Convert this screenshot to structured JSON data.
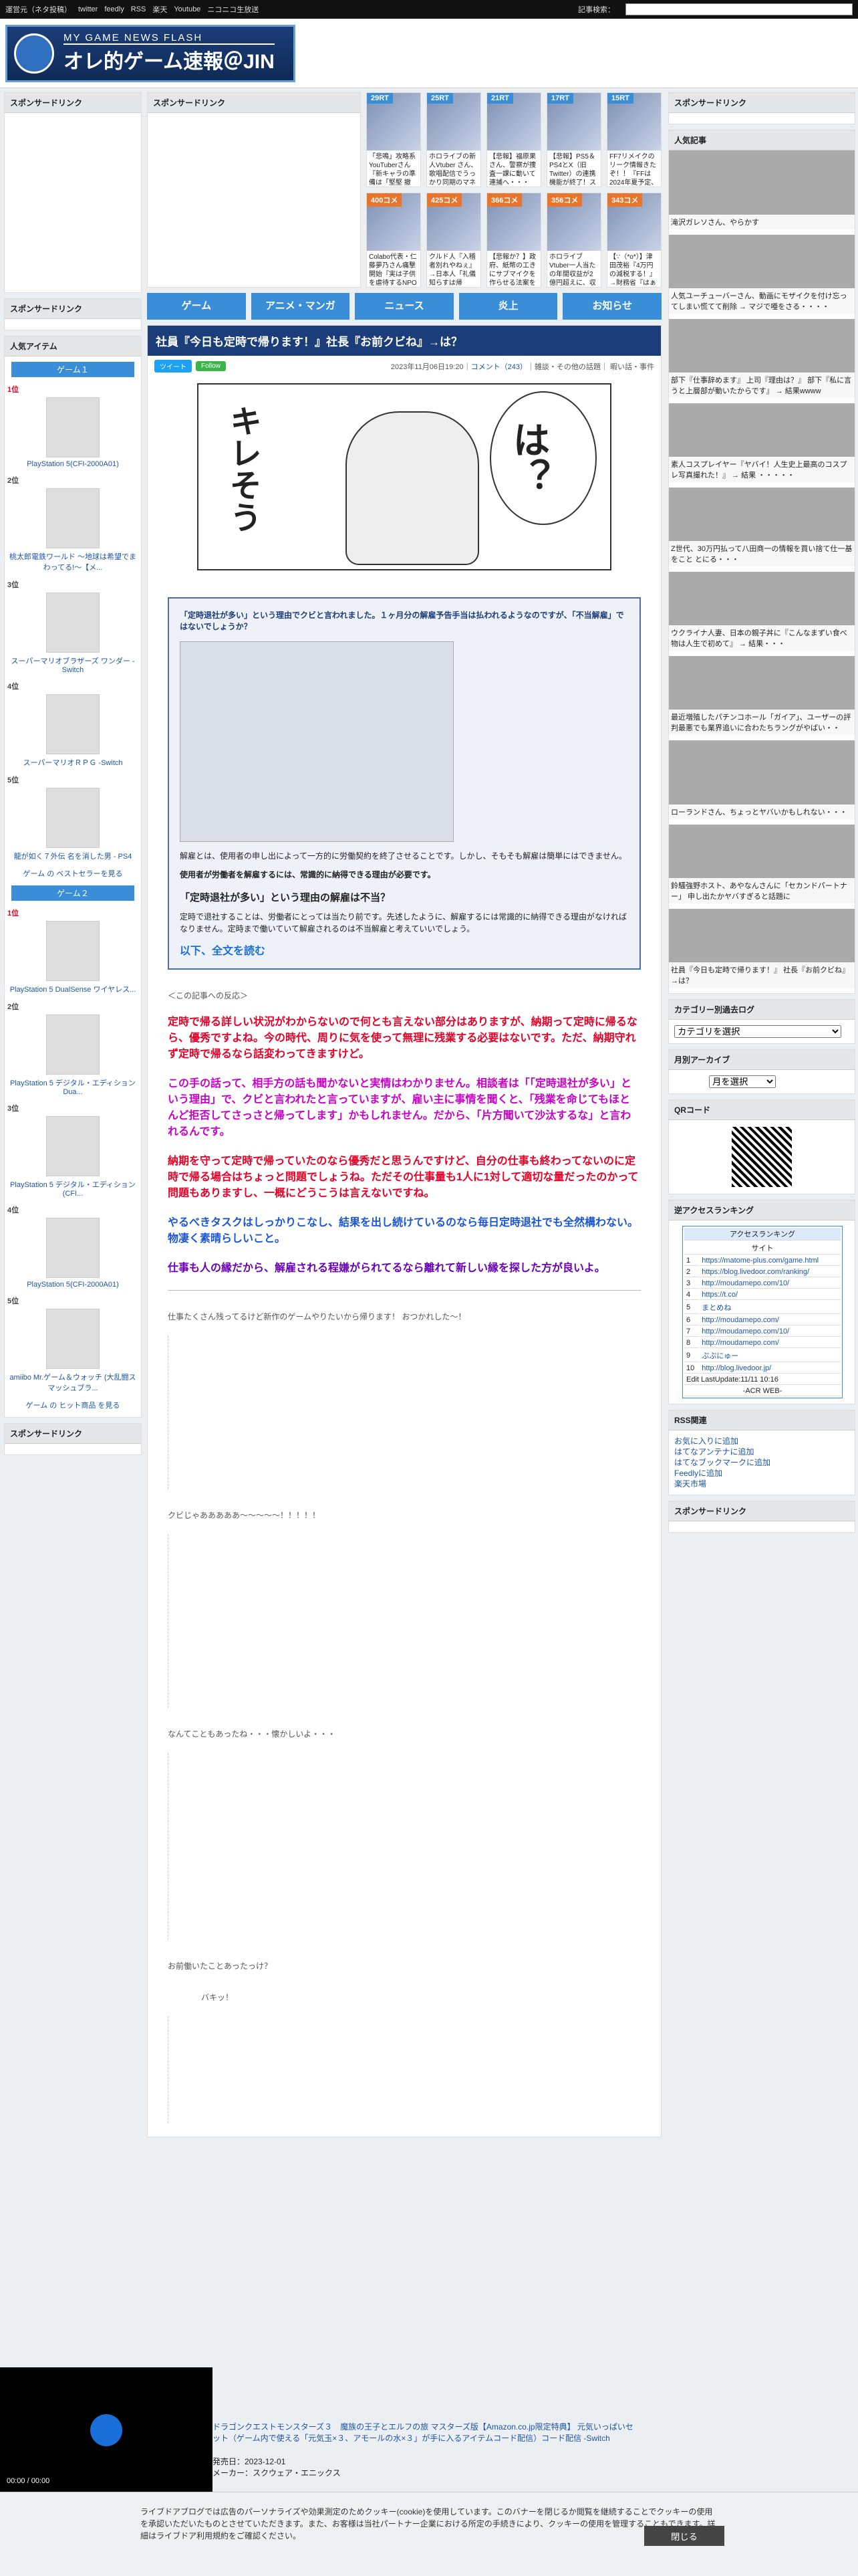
{
  "topbar": {
    "links": [
      "運営元（ネタ投稿）",
      "twitter",
      "feedly",
      "RSS",
      "楽天",
      "Youtube",
      "ニコニコ生放送"
    ],
    "search_label": "記事検索："
  },
  "header": {
    "logo_top": "MY GAME NEWS FLASH",
    "logo_main": "オレ的ゲーム速報＠JIN"
  },
  "sponsored": "スポンサードリンク",
  "thumbs": [
    {
      "badge": "29RT",
      "text": "「悲鳴」攻略系YouTuberさん『新キャラの準備は「堅堅 撤退」だ』という無名声優さん"
    },
    {
      "badge": "25RT",
      "text": "ホロライブの新人Vtuber さん、歌唱配信でうっかり同期のマネージャーが表だとバラ"
    },
    {
      "badge": "21RT",
      "text": "【悲報】福原果さん、警察が捜査一課に動いて連捕へ・・・"
    },
    {
      "badge": "17RT",
      "text": "【悲報】PS5＆PS4とX（旧Twitter）の連携機能が終了！スクショや動画を直接投稿出"
    },
    {
      "badge": "15RT",
      "text": "FF7リメイクのリーク情報きたぞ！！『FFは2024年夏予定、FF10 は楽はは今のとこ"
    },
    {
      "badge": "400コメ",
      "text": "Colabo代表・仁藤夢乃さん痛撃開始『実は子供を虐待するNPO で自分の性癖のが"
    },
    {
      "badge": "425コメ",
      "text": "クルド人『入稽者別れやねぇ』→日本人「礼儀知らすは帰れ！」→クルド人「日本人"
    },
    {
      "badge": "366コメ",
      "text": "【悲報か？】政府、紙幣の工きにサブマイクを作らせる法案を提出へ"
    },
    {
      "badge": "356コメ",
      "text": "ホロライブ Vtuber一人当たの年間収益が2億円超えに、収者再生ネ・・・"
    },
    {
      "badge": "343コメ",
      "text": "【∵（*o*）】津田茂裕『4万円の減税する！』→財務省『はぁそんな金無ないから』"
    }
  ],
  "nav": [
    "ゲーム",
    "アニメ・マンガ",
    "ニュース",
    "炎上",
    "お知らせ"
  ],
  "article": {
    "title": "社員『今日も定時で帰ります！』社長『お前クビね』→は？",
    "date": "2023年11月06日19:20",
    "comments": "コメント（243）",
    "tags": "雑談・その他の話題｜ 暇い話・事件",
    "tweet": "ツイート",
    "follow": "Follow",
    "manga_text1": "キレそう",
    "manga_text2": "は？",
    "quote_head": "「定時退社が多い」という理由でクビと言われました。１ヶ月分の解雇予告手当は払われるようなのですが、「不当解雇」ではないでしょうか？",
    "quote_p1": "解雇とは、使用者の申し出によって一方的に労働契約を終了させることです。しかし、そもそも解雇は簡単にはできません。",
    "quote_p2": "使用者が労働者を解雇するには、常識的に納得できる理由が必要です。",
    "quote_h2": "「定時退社が多い」という理由の解雇は不当？",
    "quote_p3": "定時で退社することは、労働者にとっては当たり前です。先述したように、解雇するには常識的に納得できる理由がなければなりません。定時まで働いていて解雇されるのは不当解雇と考えていいでしょう。",
    "more": "以下、全文を読む",
    "reaction": "＜この記事への反応＞",
    "c1": "定時で帰る詳しい状況がわからないので何とも言えない部分はありますが、納期って定時に帰るなら、優秀ですよね。今の時代、周りに気を使って無理に残業する必要はないです。ただ、納期守れず定時で帰るなら話変わってきますけど。",
    "c2": "この手の話って、相手方の話も聞かないと実情はわかりません。相談者は「「定時退社が多い」という理由」で、クビと言われたと言っていますが、雇い主に事情を聞くと、「残業を命じてもほとんど拒否してさっさと帰ってします」かもしれません。だから、「片方聞いて沙汰するな」と言われるんです。",
    "c3": "納期を守って定時で帰っていたのなら優秀だと思うんですけど、自分の仕事も終わってないのに定時で帰る場合はちょっと問題でしょうね。ただその仕事量も1人に1対して適切な量だったのかって問題もありますし、一概にどうこうは言えないですね。",
    "c4": "やるべきタスクはしっかりこなし、結果を出し続けているのなら毎日定時退社でも全然構わない。物凄く素晴らしいこと。",
    "c5": "仕事も人の縁だから、解雇される程嫌がられてるなら離れて新しい縁を探した方が良いよ。",
    "aa_cap1": "仕事たくさん残ってるけど新作のゲームやりたいから帰ります！ おつかれした～！",
    "aa_cap2": "クビじゃあああああ～～～～～！！！！！",
    "aa_cap3": "なんてこともあったね・・・懐かしいよ・・・",
    "aa_cap4": "お前働いたことあったっけ？",
    "aa_cap5": "バキッ！"
  },
  "left": {
    "section": "人気アイテム",
    "game1": "ゲーム１",
    "items1": [
      {
        "rank": "1位",
        "name": "PlayStation 5(CFI-2000A01)"
      },
      {
        "rank": "2位",
        "name": "桃太郎電鉄ワールド ～地球は希望でまわってる!～【メ..."
      },
      {
        "rank": "3位",
        "name": "スーパーマリオブラザーズ ワンダー -Switch"
      },
      {
        "rank": "4位",
        "name": "スーパーマリオＲＰＧ -Switch"
      },
      {
        "rank": "5位",
        "name": "龍が如く７外伝 名を消した男 - PS4"
      }
    ],
    "best1": "ゲーム の ベストセラーを見る",
    "game2": "ゲーム２",
    "items2": [
      {
        "rank": "1位",
        "name": "PlayStation 5 DualSense ワイヤレス..."
      },
      {
        "rank": "2位",
        "name": "PlayStation 5 デジタル・エディション Dua..."
      },
      {
        "rank": "3位",
        "name": "PlayStation 5 デジタル・エディション(CFI..."
      },
      {
        "rank": "4位",
        "name": "PlayStation 5(CFI-2000A01)"
      },
      {
        "rank": "5位",
        "name": "amiibo Mr.ゲーム＆ウォッチ (大乱闘スマッシュブラ..."
      }
    ],
    "best2": "ゲーム の ヒット商品 を見る"
  },
  "right": {
    "popular": "人気記事",
    "articles": [
      "滝沢ガレソさん、やらかす",
      "人気ユーチューバーさん、動画にモザイクを付け忘ってしまい慌てて削除 → マジで唖をさる・・・・",
      "部下『仕事辞めます』 上司『理由は？』 部下『私に言うと上層部が動いたからです』 → 結果wwww",
      "素人コスプレイヤー『ヤバイ！人生史上最高のコスプレ写真撮れた！』 → 結果 ・・・・・",
      "Z世代、30万円払って八田商一の情報を買い捨て仕一基をこと とにる・・・",
      "ウクライナ人妻、日本の親子丼に『こんなまずい食べ物は人生で初めて』 → 結果・・・",
      "最近増殖したパチンコホール「ガイア」、ユーザーの評判最悪でも業界追いに合わたちラングがやばい・・",
      "ローランドさん、ちょっとヤバいかもしれない・・・",
      "鈴騒強野ホスト、あやなんさんに「セカンドパートナー」 申し出たかヤバすぎると話題に",
      "社員『今日も定時で帰ります！』 社長『お前クビね』→は？"
    ],
    "category": "カテゴリー別過去ログ",
    "cat_select": "カテゴリを選択",
    "archive": "月別アーカイブ",
    "month_select": "月を選択",
    "qr": "QRコード",
    "reverse": "逆アクセスランキング",
    "rank_head": "アクセスランキング",
    "rank_sub": "サイト",
    "ranks": [
      "https://matome-plus.com/game.html",
      "https://blog.livedoor.com/ranking/",
      "http://moudamepo.com/10/",
      "https://t.co/",
      "まとめね",
      "http://moudamepo.com/",
      "http://moudamepo.com/10/",
      "http://moudamepo.com/",
      "ぷぷにゅー",
      "http://blog.livedoor.jp/"
    ],
    "rank_foot": "Edit LastUpdate:11/11 10:16",
    "rank_by": "-ACR WEB-",
    "rss": "RSS関連",
    "rss_links": [
      "お気に入りに追加",
      "はてなアンテナに追加",
      "はてなブックマークに追加",
      "Feedlyに追加",
      "楽天市場"
    ]
  },
  "player": {
    "time": "00:00 / 00:00"
  },
  "product": {
    "title": "ドラゴンクエストモンスターズ３　魔族の王子とエルフの旅 マスターズ版【Amazon.co.jp限定特典】 元気いっぱいセット（ゲーム内で使える「元気玉×３、アモールの水×３」が手に入るアイテムコード配信）コード配信 -Switch",
    "date": "発売日：2023-12-01",
    "maker": "メーカー：スクウェア・エニックス"
  },
  "cookie": {
    "text": "ライブドアブログでは広告のパーソナライズや効果測定のためクッキー(cookie)を使用しています。このバナーを閉じるか閲覧を継続することでクッキーの使用を承認いただいたものとさせていただきます。また、お客様は当社パートナー企業における所定の手続きにより、クッキーの使用を管理することもできます。詳細はライブドア利用規約をご確認ください。",
    "close": "閉じる"
  }
}
